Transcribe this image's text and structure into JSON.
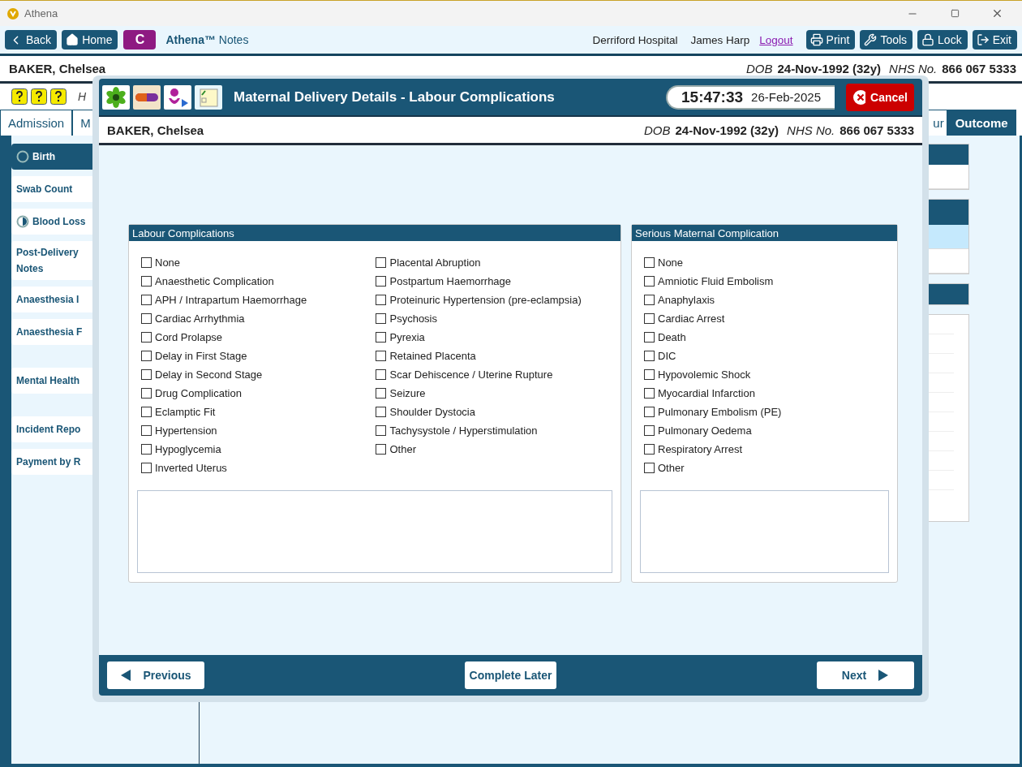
{
  "window": {
    "title": "Athena"
  },
  "toolbar": {
    "left_buttons": [
      {
        "label": "Back"
      },
      {
        "label": "Home"
      }
    ],
    "badge": "C",
    "app_name": "Athena™",
    "app_subtitle": "Notes",
    "hospital": "Derriford Hospital",
    "user": "James Harp",
    "logout": "Logout",
    "right_buttons": [
      {
        "label": "Print"
      },
      {
        "label": "Tools"
      },
      {
        "label": "Lock"
      },
      {
        "label": "Exit"
      }
    ]
  },
  "patient": {
    "name": "BAKER, Chelsea",
    "dob_label": "DOB",
    "dob": "24-Nov-1992 (32y)",
    "nhs_label": "NHS No.",
    "nhs": "866 067 5333"
  },
  "quick_bar": {
    "text": "H"
  },
  "tabs": [
    {
      "label": "Admission",
      "selected": false
    },
    {
      "label": "M",
      "selected": false
    },
    {
      "label": "ur",
      "selected": false
    },
    {
      "label": "Outcome",
      "selected": true
    }
  ],
  "sidebar": {
    "groups": [
      [
        {
          "label": "Birth",
          "kind": "empty",
          "selected": true
        },
        {
          "label": "Swab Count",
          "selected": false
        },
        {
          "label": "Blood Loss",
          "kind": "half",
          "selected": false
        },
        {
          "label": "Post-Delivery Notes",
          "selected": false
        },
        {
          "label": "Anaesthesia I",
          "selected": false
        },
        {
          "label": "Anaesthesia F",
          "selected": false
        }
      ],
      [
        {
          "label": "Mental Health",
          "selected": false
        }
      ],
      [
        {
          "label": "Incident Repo",
          "selected": false
        },
        {
          "label": "Payment by R",
          "selected": false
        }
      ]
    ]
  },
  "dialog": {
    "title": "Maternal Delivery Details - Labour Complications",
    "time": "15:47:33",
    "date": "26-Feb-2025",
    "cancel": "Cancel",
    "patient": {
      "name": "BAKER, Chelsea",
      "dob_label": "DOB",
      "dob": "24-Nov-1992 (32y)",
      "nhs_label": "NHS No.",
      "nhs": "866 067 5333"
    },
    "sections": [
      {
        "title": "Labour Complications",
        "columns": [
          [
            {
              "label": "None",
              "checked": false
            },
            {
              "label": "Anaesthetic Complication",
              "checked": false
            },
            {
              "label": "APH / Intrapartum Haemorrhage",
              "checked": false
            },
            {
              "label": "Cardiac Arrhythmia",
              "checked": false
            },
            {
              "label": "Cord Prolapse",
              "checked": false
            },
            {
              "label": "Delay in First Stage",
              "checked": false
            },
            {
              "label": "Delay in Second Stage",
              "checked": false
            },
            {
              "label": "Drug Complication",
              "checked": false
            },
            {
              "label": "Eclamptic Fit",
              "checked": false
            },
            {
              "label": "Hypertension",
              "checked": false
            },
            {
              "label": "Hypoglycemia",
              "checked": false
            },
            {
              "label": "Inverted Uterus",
              "checked": false
            }
          ],
          [
            {
              "label": "Placental Abruption",
              "checked": false
            },
            {
              "label": "Postpartum Haemorrhage",
              "checked": false
            },
            {
              "label": "Proteinuric Hypertension (pre-eclampsia)",
              "checked": false
            },
            {
              "label": "Psychosis",
              "checked": false
            },
            {
              "label": "Pyrexia",
              "checked": false
            },
            {
              "label": "Retained Placenta",
              "checked": false
            },
            {
              "label": "Scar Dehiscence / Uterine Rupture",
              "checked": false
            },
            {
              "label": "Seizure",
              "checked": false
            },
            {
              "label": "Shoulder Dystocia",
              "checked": false
            },
            {
              "label": "Tachysystole / Hyperstimulation",
              "checked": false
            },
            {
              "label": "Other",
              "checked": false
            }
          ]
        ]
      },
      {
        "title": "Serious Maternal Complication",
        "columns": [
          [
            {
              "label": "None",
              "checked": false
            },
            {
              "label": "Amniotic Fluid Embolism",
              "checked": false
            },
            {
              "label": "Anaphylaxis",
              "checked": false
            },
            {
              "label": "Cardiac Arrest",
              "checked": false
            },
            {
              "label": "Death",
              "checked": false
            },
            {
              "label": "DIC",
              "checked": false
            },
            {
              "label": "Hypovolemic Shock",
              "checked": false
            },
            {
              "label": "Myocardial Infarction",
              "checked": false
            },
            {
              "label": "Pulmonary Embolism (PE)",
              "checked": false
            },
            {
              "label": "Pulmonary Oedema",
              "checked": false
            },
            {
              "label": "Respiratory Arrest",
              "checked": false
            },
            {
              "label": "Other",
              "checked": false
            }
          ]
        ]
      }
    ],
    "footer": {
      "previous": "Previous",
      "complete_later": "Complete Later",
      "next": "Next"
    }
  }
}
